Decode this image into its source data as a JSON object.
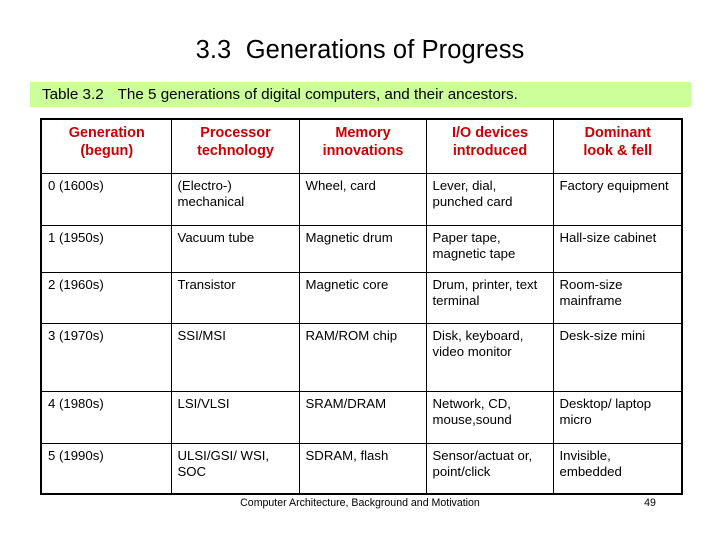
{
  "slide": {
    "title": "3.3  Generations of Progress",
    "caption": {
      "label": "Table 3.2",
      "text": "The 5 generations of digital computers, and their ancestors."
    },
    "footer": {
      "text": "Computer Architecture, Background and Motivation",
      "page_number": "49"
    },
    "colors": {
      "caption_background": "#ccff99",
      "header_text": "#cc0000",
      "body_text": "#000000",
      "border": "#000000",
      "slide_background": "#ffffff"
    }
  },
  "table": {
    "headers": [
      "Generation\n(begun)",
      "Processor\ntechnology",
      "Memory\ninnovations",
      "I/O devices\nintroduced",
      "Dominant\nlook & fell"
    ],
    "rows": [
      {
        "generation": "0 (1600s)",
        "processor": "(Electro-) mechanical",
        "memory": "Wheel, card",
        "io": "Lever, dial, punched card",
        "look": "Factory equipment"
      },
      {
        "generation": "1 (1950s)",
        "processor": "Vacuum tube",
        "memory": "Magnetic drum",
        "io": "Paper tape, magnetic tape",
        "look": "Hall-size cabinet"
      },
      {
        "generation": "2 (1960s)",
        "processor": "Transistor",
        "memory": "Magnetic core",
        "io": "Drum, printer, text terminal",
        "look": "Room-size mainframe"
      },
      {
        "generation": "3 (1970s)",
        "processor": "SSI/MSI",
        "memory": "RAM/ROM chip",
        "io": "Disk, keyboard, video monitor",
        "look": "Desk-size mini"
      },
      {
        "generation": "4 (1980s)",
        "processor": "LSI/VLSI",
        "memory": "SRAM/DRAM",
        "io": "Network, CD, mouse,sound",
        "look": "Desktop/ laptop micro"
      },
      {
        "generation": "5 (1990s)",
        "processor": "ULSI/GSI/ WSI, SOC",
        "memory": "SDRAM, flash",
        "io": "Sensor/actuat or, point/click",
        "look": "Invisible, embedded"
      }
    ]
  }
}
